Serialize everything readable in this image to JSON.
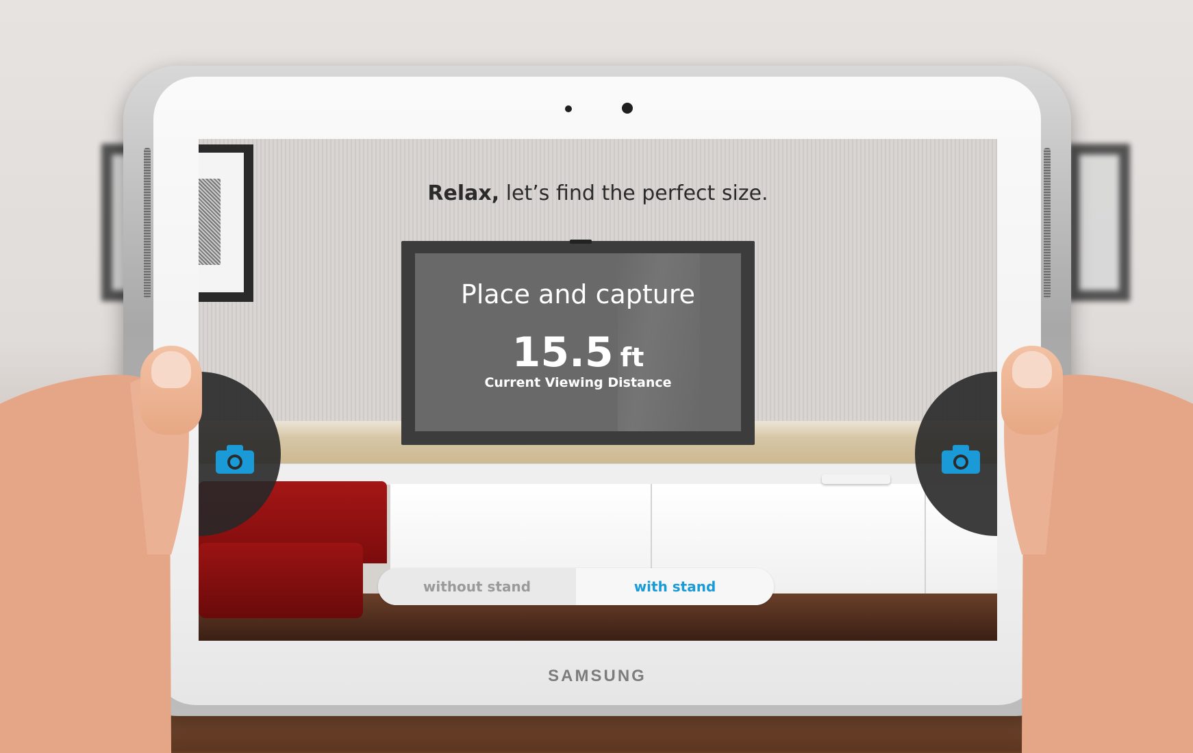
{
  "screen": {
    "headline_bold": "Relax,",
    "headline_rest": " let’s find the perfect size.",
    "tv": {
      "title": "Place and capture",
      "distance_value": "15.5",
      "distance_unit": "ft",
      "distance_label": "Current Viewing Distance"
    },
    "capture_left_icon": "camera-icon",
    "capture_right_icon": "camera-icon",
    "stand_toggle": {
      "options": [
        "without stand",
        "with stand"
      ],
      "selected": "with stand"
    }
  },
  "device": {
    "brand": "SAMSUNG"
  },
  "colors": {
    "accent": "#1a9ad6",
    "overlay": "#3c3c3c"
  }
}
